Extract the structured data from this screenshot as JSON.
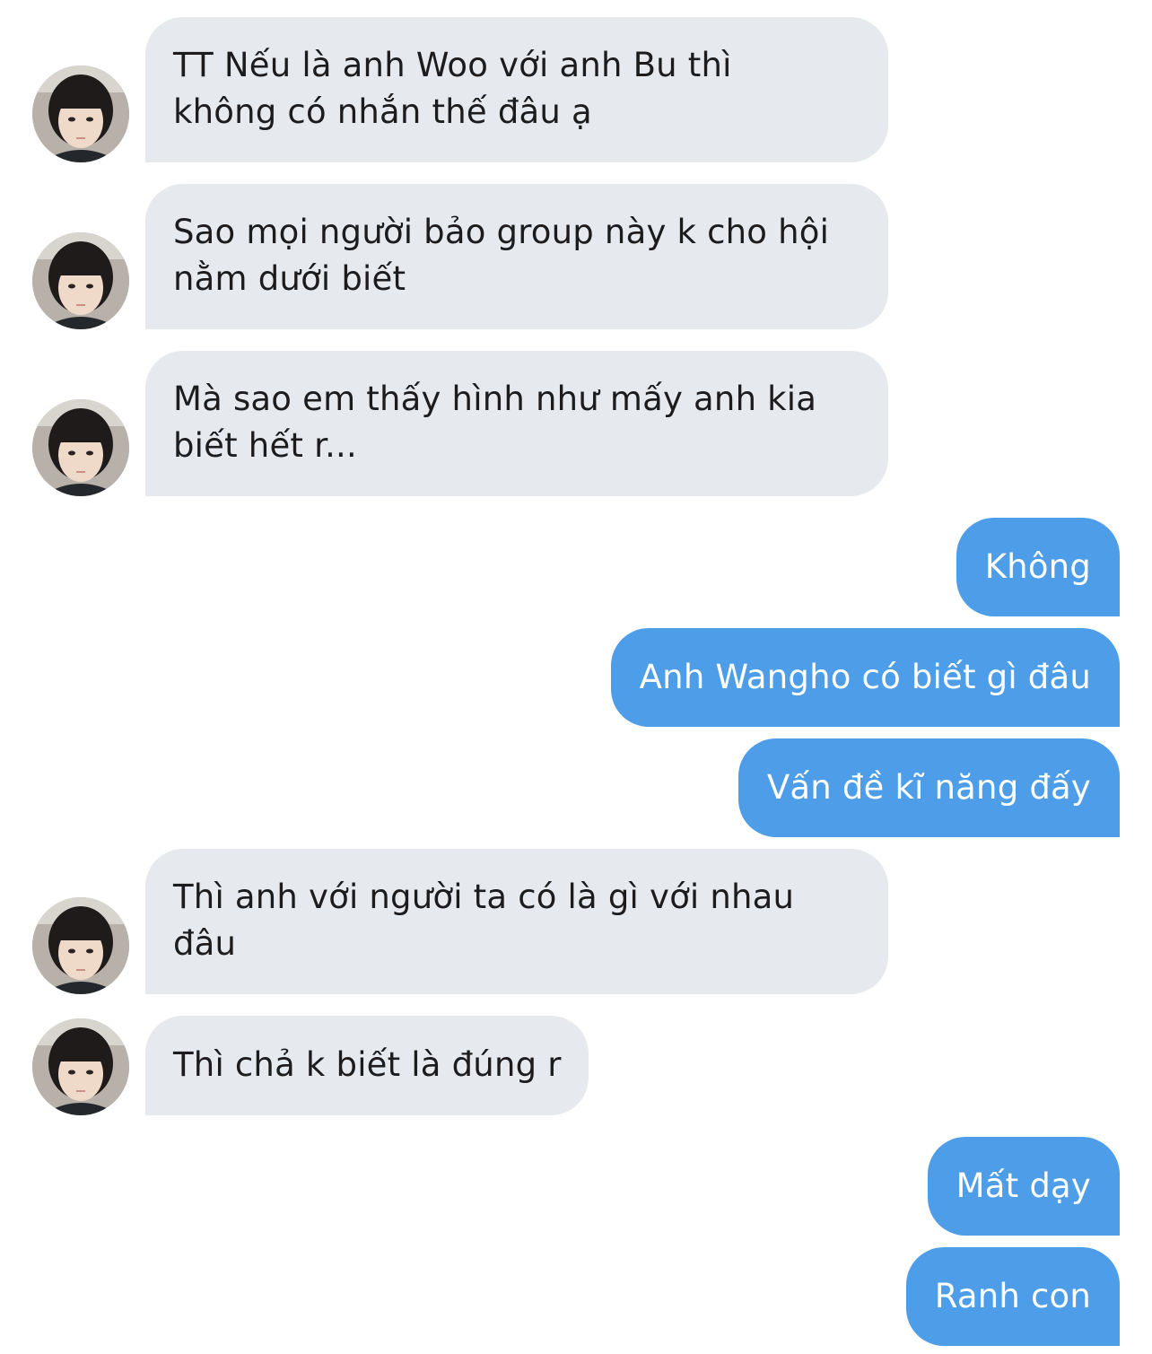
{
  "conversation": {
    "messages": [
      {
        "direction": "incoming",
        "lines": [
          "TT Nếu là anh Woo với anh Bu thì",
          "không có nhắn thế đâu ạ"
        ]
      },
      {
        "direction": "incoming",
        "lines": [
          "Sao mọi người bảo group này k cho hội",
          "nằm dưới biết"
        ]
      },
      {
        "direction": "incoming",
        "lines": [
          "Mà sao em thấy hình như mấy anh kia",
          "biết hết r..."
        ]
      },
      {
        "direction": "outgoing",
        "lines": [
          "Không"
        ]
      },
      {
        "direction": "outgoing",
        "lines": [
          "Anh Wangho có biết gì đâu"
        ]
      },
      {
        "direction": "outgoing",
        "lines": [
          "Vấn đề kĩ năng đấy"
        ]
      },
      {
        "direction": "incoming",
        "lines": [
          "Thì anh với người ta có là gì với nhau",
          "đâu"
        ]
      },
      {
        "direction": "incoming",
        "lines": [
          "Thì chả k biết là đúng r"
        ]
      },
      {
        "direction": "outgoing",
        "lines": [
          "Mất dạy"
        ]
      },
      {
        "direction": "outgoing",
        "lines": [
          "Ranh con"
        ]
      }
    ]
  },
  "colors": {
    "incoming_bubble": "#e6eaee",
    "incoming_text": "#1c1c1e",
    "outgoing_bubble": "#4d9de8",
    "outgoing_text": "#ffffff",
    "background": "#ffffff"
  },
  "icons": {
    "avatar": "contact-avatar-photo"
  }
}
